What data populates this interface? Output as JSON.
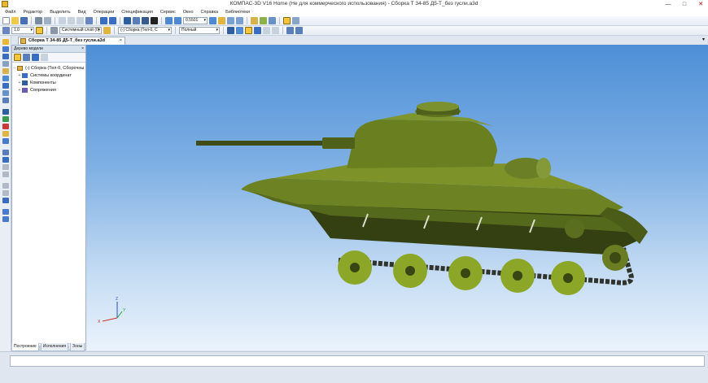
{
  "window": {
    "title": "КОМПАС-3D V16 Home  (Не для коммерческого использования) - Сборка Т 34-85 Д5-Т_без гусли.a3d",
    "controls": [
      "—",
      "□",
      "✕"
    ]
  },
  "menu": [
    "Файл",
    "Редактор",
    "Выделить",
    "Вид",
    "Операции",
    "Спецификация",
    "Сервис",
    "Окно",
    "Справка",
    "Библиотеки"
  ],
  "toolbar1": {
    "zoom_value": "0.5501"
  },
  "toolbar2": {
    "step_value": "1.0",
    "layer_value": "Системный слой (0)",
    "assembly_value": "(-) Сборка (Тел-0, С",
    "display_mode": "Полный"
  },
  "document_tab": {
    "label": "Сборка Т 34-85 Д5-Т_без гусли.a3d",
    "close": "×"
  },
  "model_tree": {
    "header": "Дерево модели",
    "close": "×",
    "items": [
      {
        "label": "(-) Сборка (Тел-0, Сборочны",
        "expander": "−"
      },
      {
        "label": "Системы координат",
        "expander": "+"
      },
      {
        "label": "Компоненты",
        "expander": "+"
      },
      {
        "label": "Сопряжения",
        "expander": "+"
      }
    ]
  },
  "panel_tabs": [
    "Построение",
    "Исполнения",
    "Зоны"
  ],
  "axis_labels": {
    "x": "X",
    "y": "Y",
    "z": "Z"
  },
  "colors": {
    "hull": "#55691c",
    "hull_dark": "#343f12",
    "wheel": "#8ca627",
    "track": "#4a4f46",
    "sky_top": "#4d8fd6"
  }
}
